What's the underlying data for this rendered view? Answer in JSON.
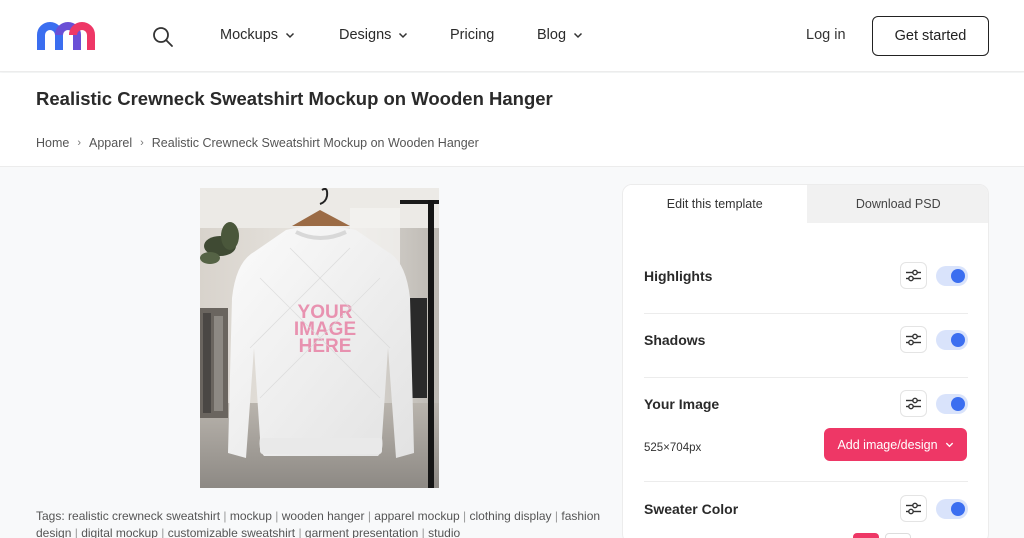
{
  "header": {
    "logo_colors": [
      "#3b6ef0",
      "#ee3766"
    ],
    "nav": [
      {
        "label": "Mockups",
        "has_dropdown": true
      },
      {
        "label": "Designs",
        "has_dropdown": true
      },
      {
        "label": "Pricing",
        "has_dropdown": false
      },
      {
        "label": "Blog",
        "has_dropdown": true
      }
    ],
    "login_label": "Log in",
    "cta_label": "Get started"
  },
  "page": {
    "title": "Realistic Crewneck Sweatshirt Mockup on Wooden Hanger",
    "breadcrumb": [
      "Home",
      "Apparel",
      "Realistic Crewneck Sweatshirt Mockup on Wooden Hanger"
    ]
  },
  "preview": {
    "placeholder_lines": [
      "YOUR",
      "IMAGE",
      "HERE"
    ]
  },
  "tags": {
    "label": "Tags:",
    "items": [
      "realistic crewneck sweatshirt",
      "mockup",
      "wooden hanger",
      "apparel mockup",
      "clothing display",
      "fashion design",
      "digital mockup",
      "customizable sweatshirt",
      "garment presentation",
      "studio"
    ]
  },
  "panel": {
    "tabs": [
      {
        "label": "Edit this template",
        "active": true
      },
      {
        "label": "Download PSD",
        "active": false
      }
    ],
    "layers": [
      {
        "name": "Highlights",
        "enabled": true
      },
      {
        "name": "Shadows",
        "enabled": true
      },
      {
        "name": "Your Image",
        "enabled": true
      },
      {
        "name": "Sweater Color",
        "enabled": true
      }
    ],
    "image_dimensions": "525×704px",
    "add_image_label": "Add image/design",
    "accent_color": "#ee3766",
    "toggle_color": "#3b6ef0"
  }
}
